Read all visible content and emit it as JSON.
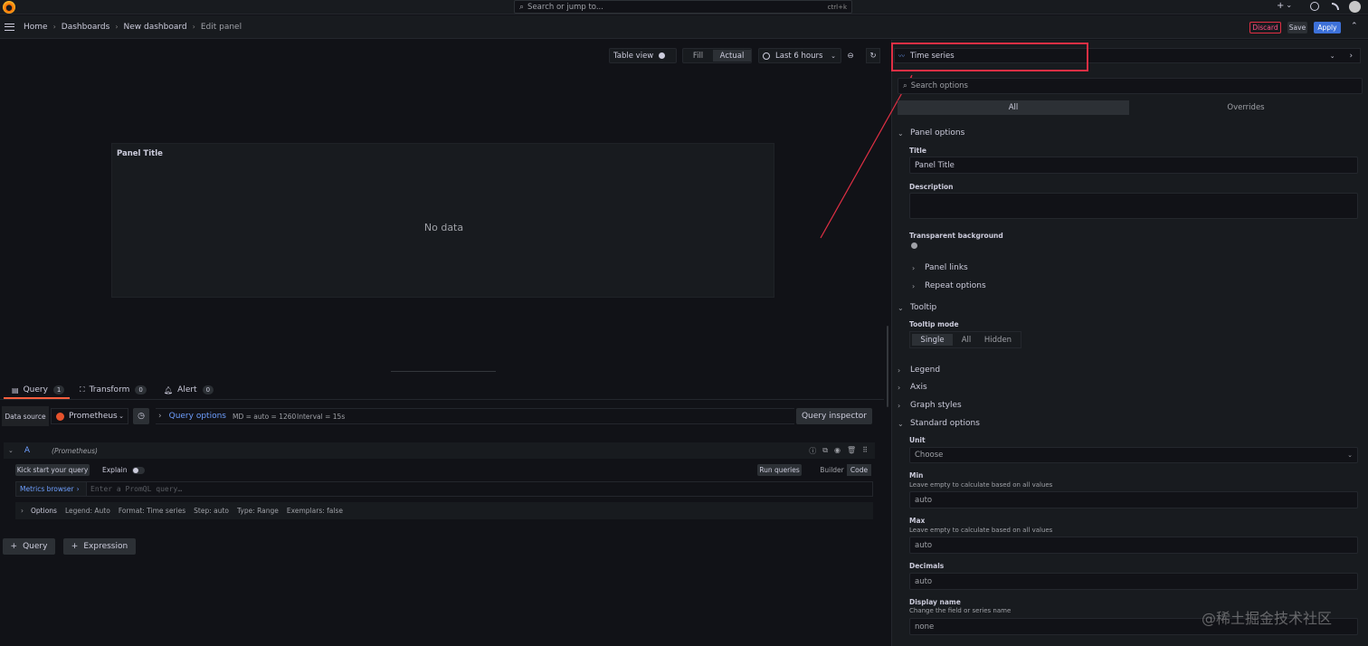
{
  "topbar": {
    "search_placeholder": "Search or jump to...",
    "shortcut": "ctrl+k",
    "plus": "+",
    "caret": "⌄"
  },
  "breadcrumb": [
    "Home",
    "Dashboards",
    "New dashboard",
    "Edit panel"
  ],
  "actions": {
    "discard": "Discard",
    "save": "Save",
    "apply": "Apply"
  },
  "panel_toolbar": {
    "table_view": "Table view",
    "fill": "Fill",
    "actual": "Actual",
    "time_range": "Last 6 hours"
  },
  "panel": {
    "title": "Panel Title",
    "empty": "No data"
  },
  "tabs": [
    {
      "label": "Query",
      "count": "1"
    },
    {
      "label": "Transform",
      "count": "0"
    },
    {
      "label": "Alert",
      "count": "0"
    }
  ],
  "query_bar": {
    "datasource_label": "Data source",
    "datasource": "Prometheus",
    "query_options": "Query options",
    "md": "MD = auto = 1260",
    "interval": "Interval = 15s",
    "inspector": "Query inspector"
  },
  "query_a": {
    "ref": "A",
    "source": "(Prometheus)",
    "kick_start": "Kick start your query",
    "explain": "Explain",
    "run": "Run queries",
    "builder": "Builder",
    "code": "Code",
    "metrics_browser": "Metrics browser",
    "placeholder": "Enter a PromQL query…",
    "options_label": "Options",
    "legend": "Legend: Auto",
    "format": "Format: Time series",
    "step": "Step: auto",
    "type": "Type: Range",
    "exemplars": "Exemplars: false"
  },
  "add_buttons": {
    "query": "Query",
    "expression": "Expression"
  },
  "options_pane": {
    "viz": "Time series",
    "search_placeholder": "Search options",
    "tab_all": "All",
    "tab_overrides": "Overrides",
    "panel_options": "Panel options",
    "title_label": "Title",
    "title_value": "Panel Title",
    "description_label": "Description",
    "transparent_label": "Transparent background",
    "panel_links": "Panel links",
    "repeat_options": "Repeat options",
    "tooltip": "Tooltip",
    "tooltip_mode": "Tooltip mode",
    "modes": [
      "Single",
      "All",
      "Hidden"
    ],
    "legend": "Legend",
    "axis": "Axis",
    "graph_styles": "Graph styles",
    "standard_options": "Standard options",
    "unit_label": "Unit",
    "unit_value": "Choose",
    "min_label": "Min",
    "min_help": "Leave empty to calculate based on all values",
    "min_value": "auto",
    "max_label": "Max",
    "max_help": "Leave empty to calculate based on all values",
    "max_value": "auto",
    "decimals_label": "Decimals",
    "decimals_value": "auto",
    "display_name_label": "Display name",
    "display_name_help": "Change the field or series name",
    "display_name_value": "none"
  },
  "watermark": "@稀土掘金技术社区",
  "colors": {
    "accent": "#3d71d9",
    "highlight": "#e02f44",
    "brand": "#f46800"
  }
}
